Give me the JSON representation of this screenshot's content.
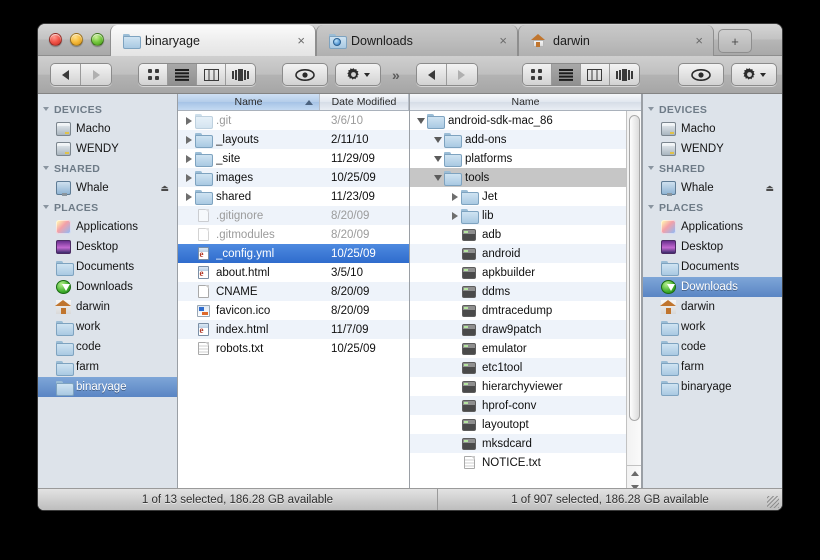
{
  "window": {
    "traffic_lights": [
      "close",
      "minimize",
      "zoom"
    ],
    "tabs": [
      {
        "label": "binaryage",
        "icon": "folder-icon",
        "active": true,
        "close": "×"
      },
      {
        "label": "Downloads",
        "icon": "downloads-folder-icon",
        "active": false,
        "close": "×"
      },
      {
        "label": "darwin",
        "icon": "home-icon",
        "active": false,
        "close": "×"
      }
    ],
    "new_tab_label": "+"
  },
  "toolbar_left": {
    "back_label": "◀",
    "forward_label": "▶",
    "view_modes": [
      "icon-view",
      "list-view",
      "column-view",
      "coverflow-view"
    ],
    "active_view": "list-view",
    "quicklook_label": "eye-icon",
    "action_label": "gear-icon",
    "overflow_label": "»"
  },
  "toolbar_right": {
    "back_label": "◀",
    "forward_label": "▶",
    "view_modes": [
      "icon-view",
      "list-view",
      "column-view",
      "coverflow-view"
    ],
    "active_view": "list-view",
    "quicklook_label": "eye-icon",
    "action_label": "gear-icon",
    "overflow_label": "»"
  },
  "sidebar_left": {
    "sections": [
      {
        "title": "DEVICES",
        "items": [
          {
            "label": "Macho",
            "icon": "disk-icon",
            "selected": false
          },
          {
            "label": "WENDY",
            "icon": "disk-icon",
            "selected": false
          }
        ]
      },
      {
        "title": "SHARED",
        "items": [
          {
            "label": "Whale",
            "icon": "screen-icon",
            "selected": false,
            "eject": "⏏"
          }
        ]
      },
      {
        "title": "PLACES",
        "items": [
          {
            "label": "Applications",
            "icon": "applications-icon",
            "selected": false
          },
          {
            "label": "Desktop",
            "icon": "desktop-icon",
            "selected": false
          },
          {
            "label": "Documents",
            "icon": "folder-icon",
            "selected": false
          },
          {
            "label": "Downloads",
            "icon": "downloads-icon",
            "selected": false
          },
          {
            "label": "darwin",
            "icon": "home-icon",
            "selected": false
          },
          {
            "label": "work",
            "icon": "folder-icon",
            "selected": false
          },
          {
            "label": "code",
            "icon": "folder-icon",
            "selected": false
          },
          {
            "label": "farm",
            "icon": "folder-icon",
            "selected": false
          },
          {
            "label": "binaryage",
            "icon": "folder-icon",
            "selected": true
          }
        ]
      }
    ]
  },
  "sidebar_right": {
    "sections": [
      {
        "title": "DEVICES",
        "items": [
          {
            "label": "Macho",
            "icon": "disk-icon",
            "selected": false
          },
          {
            "label": "WENDY",
            "icon": "disk-icon",
            "selected": false
          }
        ]
      },
      {
        "title": "SHARED",
        "items": [
          {
            "label": "Whale",
            "icon": "screen-icon",
            "selected": false,
            "eject": "⏏"
          }
        ]
      },
      {
        "title": "PLACES",
        "items": [
          {
            "label": "Applications",
            "icon": "applications-icon",
            "selected": false
          },
          {
            "label": "Desktop",
            "icon": "desktop-icon",
            "selected": false
          },
          {
            "label": "Documents",
            "icon": "folder-icon",
            "selected": false
          },
          {
            "label": "Downloads",
            "icon": "downloads-icon",
            "selected": true
          },
          {
            "label": "darwin",
            "icon": "home-icon",
            "selected": false
          },
          {
            "label": "work",
            "icon": "folder-icon",
            "selected": false
          },
          {
            "label": "code",
            "icon": "folder-icon",
            "selected": false
          },
          {
            "label": "farm",
            "icon": "folder-icon",
            "selected": false
          },
          {
            "label": "binaryage",
            "icon": "folder-icon",
            "selected": false
          }
        ]
      }
    ]
  },
  "pane_left": {
    "columns": [
      {
        "label": "Name",
        "sorted": true,
        "sort_dir": "asc"
      },
      {
        "label": "Date Modified",
        "sorted": false
      }
    ],
    "rows": [
      {
        "name": ".git",
        "date": "3/6/10",
        "icon": "folder-icon",
        "twist": "closed",
        "dim": true,
        "selected": false
      },
      {
        "name": "_layouts",
        "date": "2/11/10",
        "icon": "folder-icon",
        "twist": "closed",
        "dim": false,
        "selected": false
      },
      {
        "name": "_site",
        "date": "11/29/09",
        "icon": "folder-icon",
        "twist": "closed",
        "dim": false,
        "selected": false
      },
      {
        "name": "images",
        "date": "10/25/09",
        "icon": "folder-icon",
        "twist": "closed",
        "dim": false,
        "selected": false
      },
      {
        "name": "shared",
        "date": "11/23/09",
        "icon": "folder-icon",
        "twist": "closed",
        "dim": false,
        "selected": false
      },
      {
        "name": ".gitignore",
        "date": "8/20/09",
        "icon": "document-icon",
        "twist": "none",
        "dim": true,
        "selected": false
      },
      {
        "name": ".gitmodules",
        "date": "8/20/09",
        "icon": "document-icon",
        "twist": "none",
        "dim": true,
        "selected": false
      },
      {
        "name": "_config.yml",
        "date": "10/25/09",
        "icon": "html-document-icon",
        "twist": "none",
        "dim": false,
        "selected": true
      },
      {
        "name": "about.html",
        "date": "3/5/10",
        "icon": "html-document-icon",
        "twist": "none",
        "dim": false,
        "selected": false
      },
      {
        "name": "CNAME",
        "date": "8/20/09",
        "icon": "document-icon",
        "twist": "none",
        "dim": false,
        "selected": false
      },
      {
        "name": "favicon.ico",
        "date": "8/20/09",
        "icon": "image-icon",
        "twist": "none",
        "dim": false,
        "selected": false
      },
      {
        "name": "index.html",
        "date": "11/7/09",
        "icon": "html-document-icon",
        "twist": "none",
        "dim": false,
        "selected": false
      },
      {
        "name": "robots.txt",
        "date": "10/25/09",
        "icon": "text-document-icon",
        "twist": "none",
        "dim": false,
        "selected": false
      }
    ],
    "hscroll_thumb": "blue",
    "status": "1 of 13 selected, 186.28 GB available"
  },
  "pane_right": {
    "columns": [
      {
        "label": "Name",
        "sorted": false
      }
    ],
    "rows": [
      {
        "name": "android-sdk-mac_86",
        "indent": 0,
        "icon": "folder-icon",
        "twist": "open",
        "selected": "none"
      },
      {
        "name": "add-ons",
        "indent": 1,
        "icon": "folder-icon",
        "twist": "open",
        "selected": "none"
      },
      {
        "name": "platforms",
        "indent": 1,
        "icon": "folder-icon",
        "twist": "open",
        "selected": "none"
      },
      {
        "name": "tools",
        "indent": 1,
        "icon": "folder-icon",
        "twist": "open",
        "selected": "gray"
      },
      {
        "name": "Jet",
        "indent": 2,
        "icon": "folder-icon",
        "twist": "closed",
        "selected": "none"
      },
      {
        "name": "lib",
        "indent": 2,
        "icon": "folder-icon",
        "twist": "closed",
        "selected": "none"
      },
      {
        "name": "adb",
        "indent": 2,
        "icon": "executable-icon",
        "twist": "none",
        "selected": "none"
      },
      {
        "name": "android",
        "indent": 2,
        "icon": "executable-icon",
        "twist": "none",
        "selected": "none"
      },
      {
        "name": "apkbuilder",
        "indent": 2,
        "icon": "executable-icon",
        "twist": "none",
        "selected": "none"
      },
      {
        "name": "ddms",
        "indent": 2,
        "icon": "executable-icon",
        "twist": "none",
        "selected": "none"
      },
      {
        "name": "dmtracedump",
        "indent": 2,
        "icon": "executable-icon",
        "twist": "none",
        "selected": "none"
      },
      {
        "name": "draw9patch",
        "indent": 2,
        "icon": "executable-icon",
        "twist": "none",
        "selected": "none"
      },
      {
        "name": "emulator",
        "indent": 2,
        "icon": "executable-icon",
        "twist": "none",
        "selected": "none"
      },
      {
        "name": "etc1tool",
        "indent": 2,
        "icon": "executable-icon",
        "twist": "none",
        "selected": "none"
      },
      {
        "name": "hierarchyviewer",
        "indent": 2,
        "icon": "executable-icon",
        "twist": "none",
        "selected": "none"
      },
      {
        "name": "hprof-conv",
        "indent": 2,
        "icon": "executable-icon",
        "twist": "none",
        "selected": "none"
      },
      {
        "name": "layoutopt",
        "indent": 2,
        "icon": "executable-icon",
        "twist": "none",
        "selected": "none"
      },
      {
        "name": "mksdcard",
        "indent": 2,
        "icon": "executable-icon",
        "twist": "none",
        "selected": "none"
      },
      {
        "name": "NOTICE.txt",
        "indent": 2,
        "icon": "text-document-icon",
        "twist": "none",
        "selected": "none"
      }
    ],
    "hscroll_thumb": "gray",
    "status": "1 of 907 selected, 186.28 GB available"
  }
}
